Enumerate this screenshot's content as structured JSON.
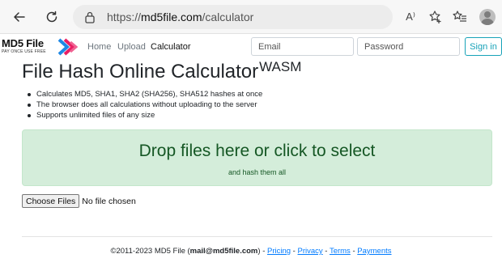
{
  "browser": {
    "url_prefix": "https://",
    "url_host": "md5file.com",
    "url_path": "/calculator",
    "read_aloud_label": "A⁾"
  },
  "navbar": {
    "brand": "MD5 File",
    "tagline": "PAY ONCE USE FREE",
    "links": [
      "Home",
      "Upload",
      "Calculator"
    ],
    "active_link": "Calculator",
    "email_placeholder": "Email",
    "password_placeholder": "Password",
    "signin_label": "Sign in"
  },
  "main": {
    "title": "File Hash Online Calculator",
    "title_sup": "WASM",
    "features": [
      "Calculates MD5, SHA1, SHA2 (SHA256), SHA512 hashes at once",
      "The browser does all calculations without uploading to the server",
      "Supports unlimited files of any size"
    ],
    "dropzone_title": "Drop files here or click to select",
    "dropzone_subtitle": "and hash them all",
    "choose_files_label": "Choose Files",
    "no_file_label": "No file chosen"
  },
  "footer": {
    "copyright": "©2011-2023 MD5 File (",
    "email": "mail@md5file.com",
    "close_paren": ") - ",
    "links": [
      "Pricing",
      "Privacy",
      "Terms",
      "Payments"
    ],
    "separator": " - "
  },
  "colors": {
    "dropzone_bg": "#d4edda",
    "dropzone_text": "#155724",
    "link": "#007bff",
    "signin": "#17a2b8"
  }
}
